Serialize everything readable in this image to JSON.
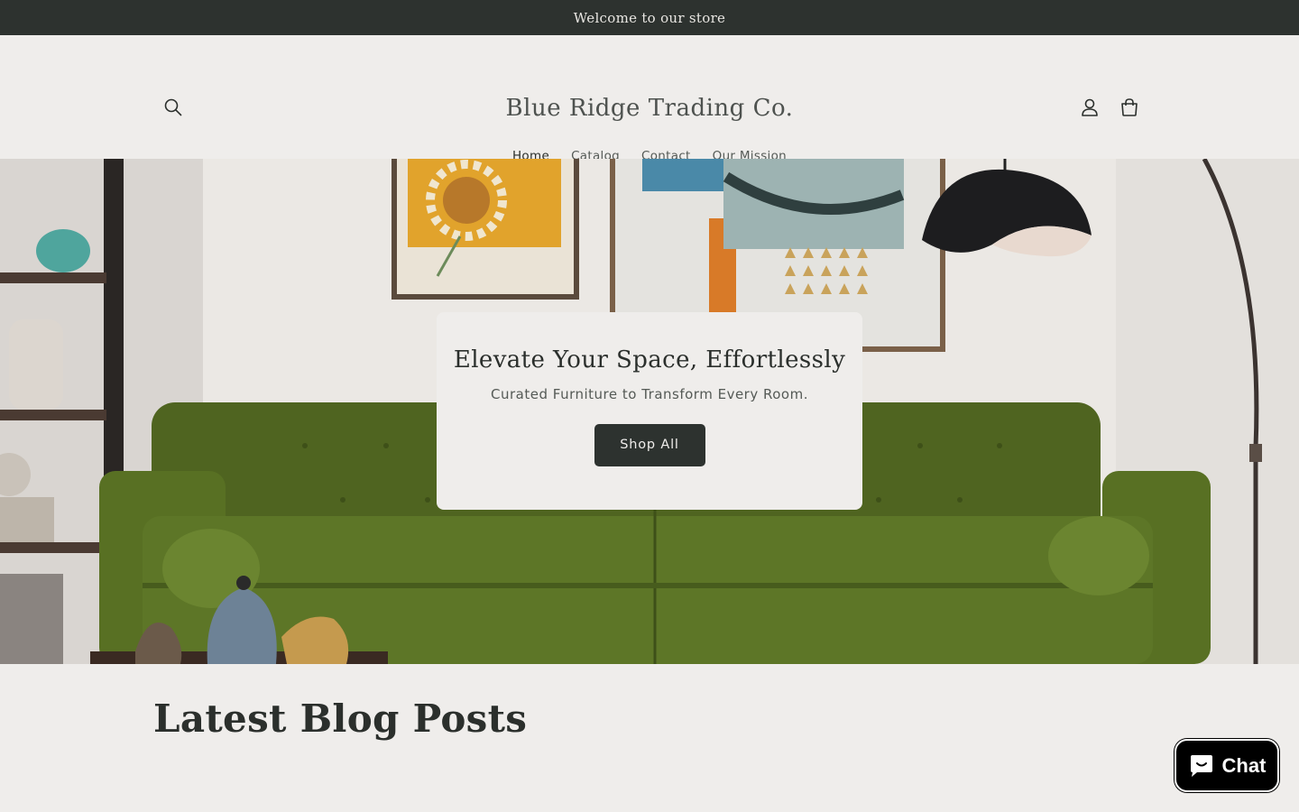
{
  "announcement": {
    "text": "Welcome to our store"
  },
  "header": {
    "logo": "Blue Ridge Trading Co.",
    "icons": {
      "search": "search-icon",
      "account": "account-icon",
      "cart": "cart-icon"
    }
  },
  "nav": {
    "items": [
      {
        "label": "Home",
        "active": true
      },
      {
        "label": "Catalog",
        "active": false
      },
      {
        "label": "Contact",
        "active": false
      },
      {
        "label": "Our Mission",
        "active": false
      }
    ]
  },
  "hero": {
    "title": "Elevate Your Space, Effortlessly",
    "subtitle": "Curated Furniture to Transform Every Room.",
    "button_label": "Shop All",
    "sofa_color": "#556b23"
  },
  "blog": {
    "title": "Latest Blog Posts"
  },
  "chat": {
    "label": "Chat",
    "icon": "chat-bubble-icon"
  },
  "colors": {
    "dark": "#2d322f",
    "background": "#efedeb",
    "chat_bg": "#000000"
  }
}
